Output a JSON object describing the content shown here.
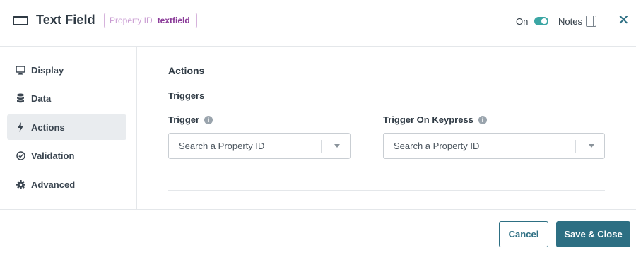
{
  "header": {
    "title": "Text Field",
    "property_id_label": "Property ID",
    "property_id_value": "textfield",
    "on_label": "On",
    "notes_label": "Notes",
    "icons": {
      "field": "text-field-icon",
      "toggle": "toggle-switch",
      "notes": "notes-panel-icon",
      "close": "close-icon"
    },
    "toggle_state": "on"
  },
  "sidebar": {
    "items": [
      {
        "label": "Display",
        "icon": "monitor-icon",
        "active": false
      },
      {
        "label": "Data",
        "icon": "database-icon",
        "active": false
      },
      {
        "label": "Actions",
        "icon": "lightning-icon",
        "active": true
      },
      {
        "label": "Validation",
        "icon": "check-circle-icon",
        "active": false
      },
      {
        "label": "Advanced",
        "icon": "gear-icon",
        "active": false
      }
    ]
  },
  "main": {
    "section_title": "Actions",
    "subsection_title": "Triggers",
    "trigger": {
      "label": "Trigger",
      "placeholder": "Search a Property ID"
    },
    "trigger_on_keypress": {
      "label": "Trigger On Keypress",
      "placeholder": "Search a Property ID"
    }
  },
  "footer": {
    "cancel_label": "Cancel",
    "save_label": "Save & Close"
  },
  "colors": {
    "primary": "#2d6f83",
    "toggle_on": "#3ba6a4",
    "badge_border": "#d6b3dc",
    "badge_value": "#8a3a98",
    "active_nav_bg": "#e9ecef"
  }
}
